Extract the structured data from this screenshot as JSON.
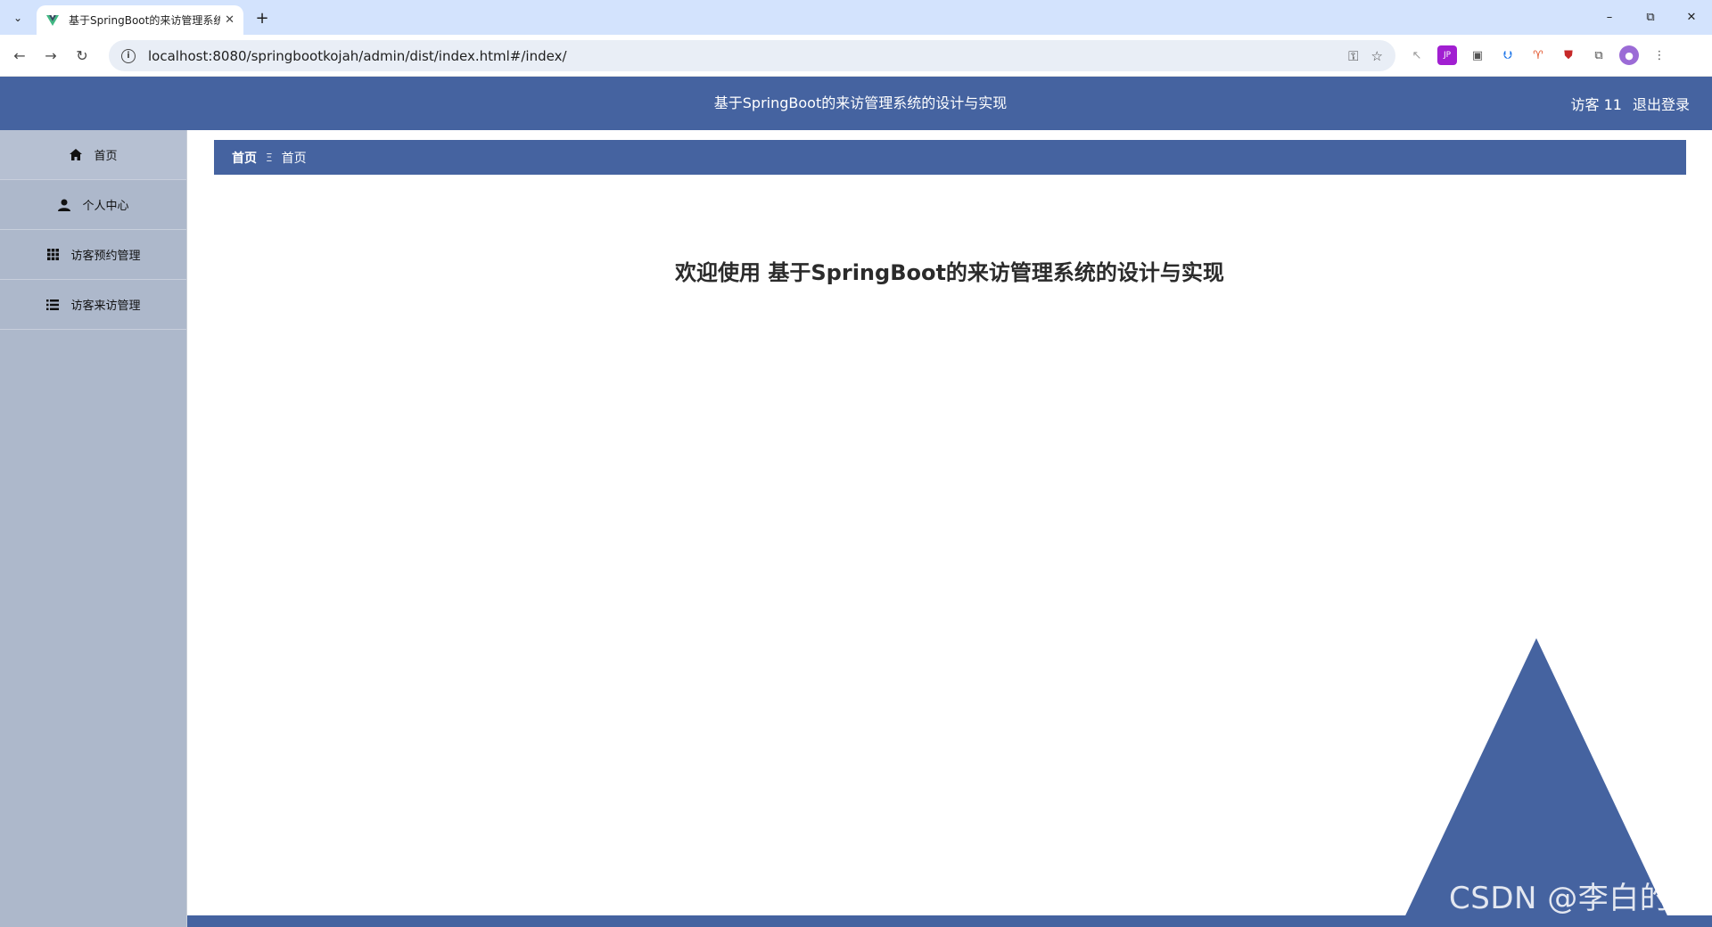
{
  "browser": {
    "tab_title": "基于SpringBoot的来访管理系统的设计与实现",
    "url": "localhost:8080/springbootkojah/admin/dist/index.html#/index/"
  },
  "app": {
    "title": "基于SpringBoot的来访管理系统的设计与实现",
    "user_label": "访客 11",
    "logout_label": "退出登录"
  },
  "sidebar": {
    "items": [
      {
        "label": "首页",
        "icon": "home-icon"
      },
      {
        "label": "个人中心",
        "icon": "user-icon"
      },
      {
        "label": "访客预约管理",
        "icon": "grid-icon"
      },
      {
        "label": "访客来访管理",
        "icon": "list-icon"
      }
    ]
  },
  "breadcrumb": {
    "first": "首页",
    "separator": "Ξ",
    "current": "首页"
  },
  "main": {
    "welcome": "欢迎使用 基于SpringBoot的来访管理系统的设计与实现"
  },
  "watermark": "CSDN @李白的粉",
  "colors": {
    "primary": "#4563a0",
    "sidebar": "#adb8cb"
  }
}
